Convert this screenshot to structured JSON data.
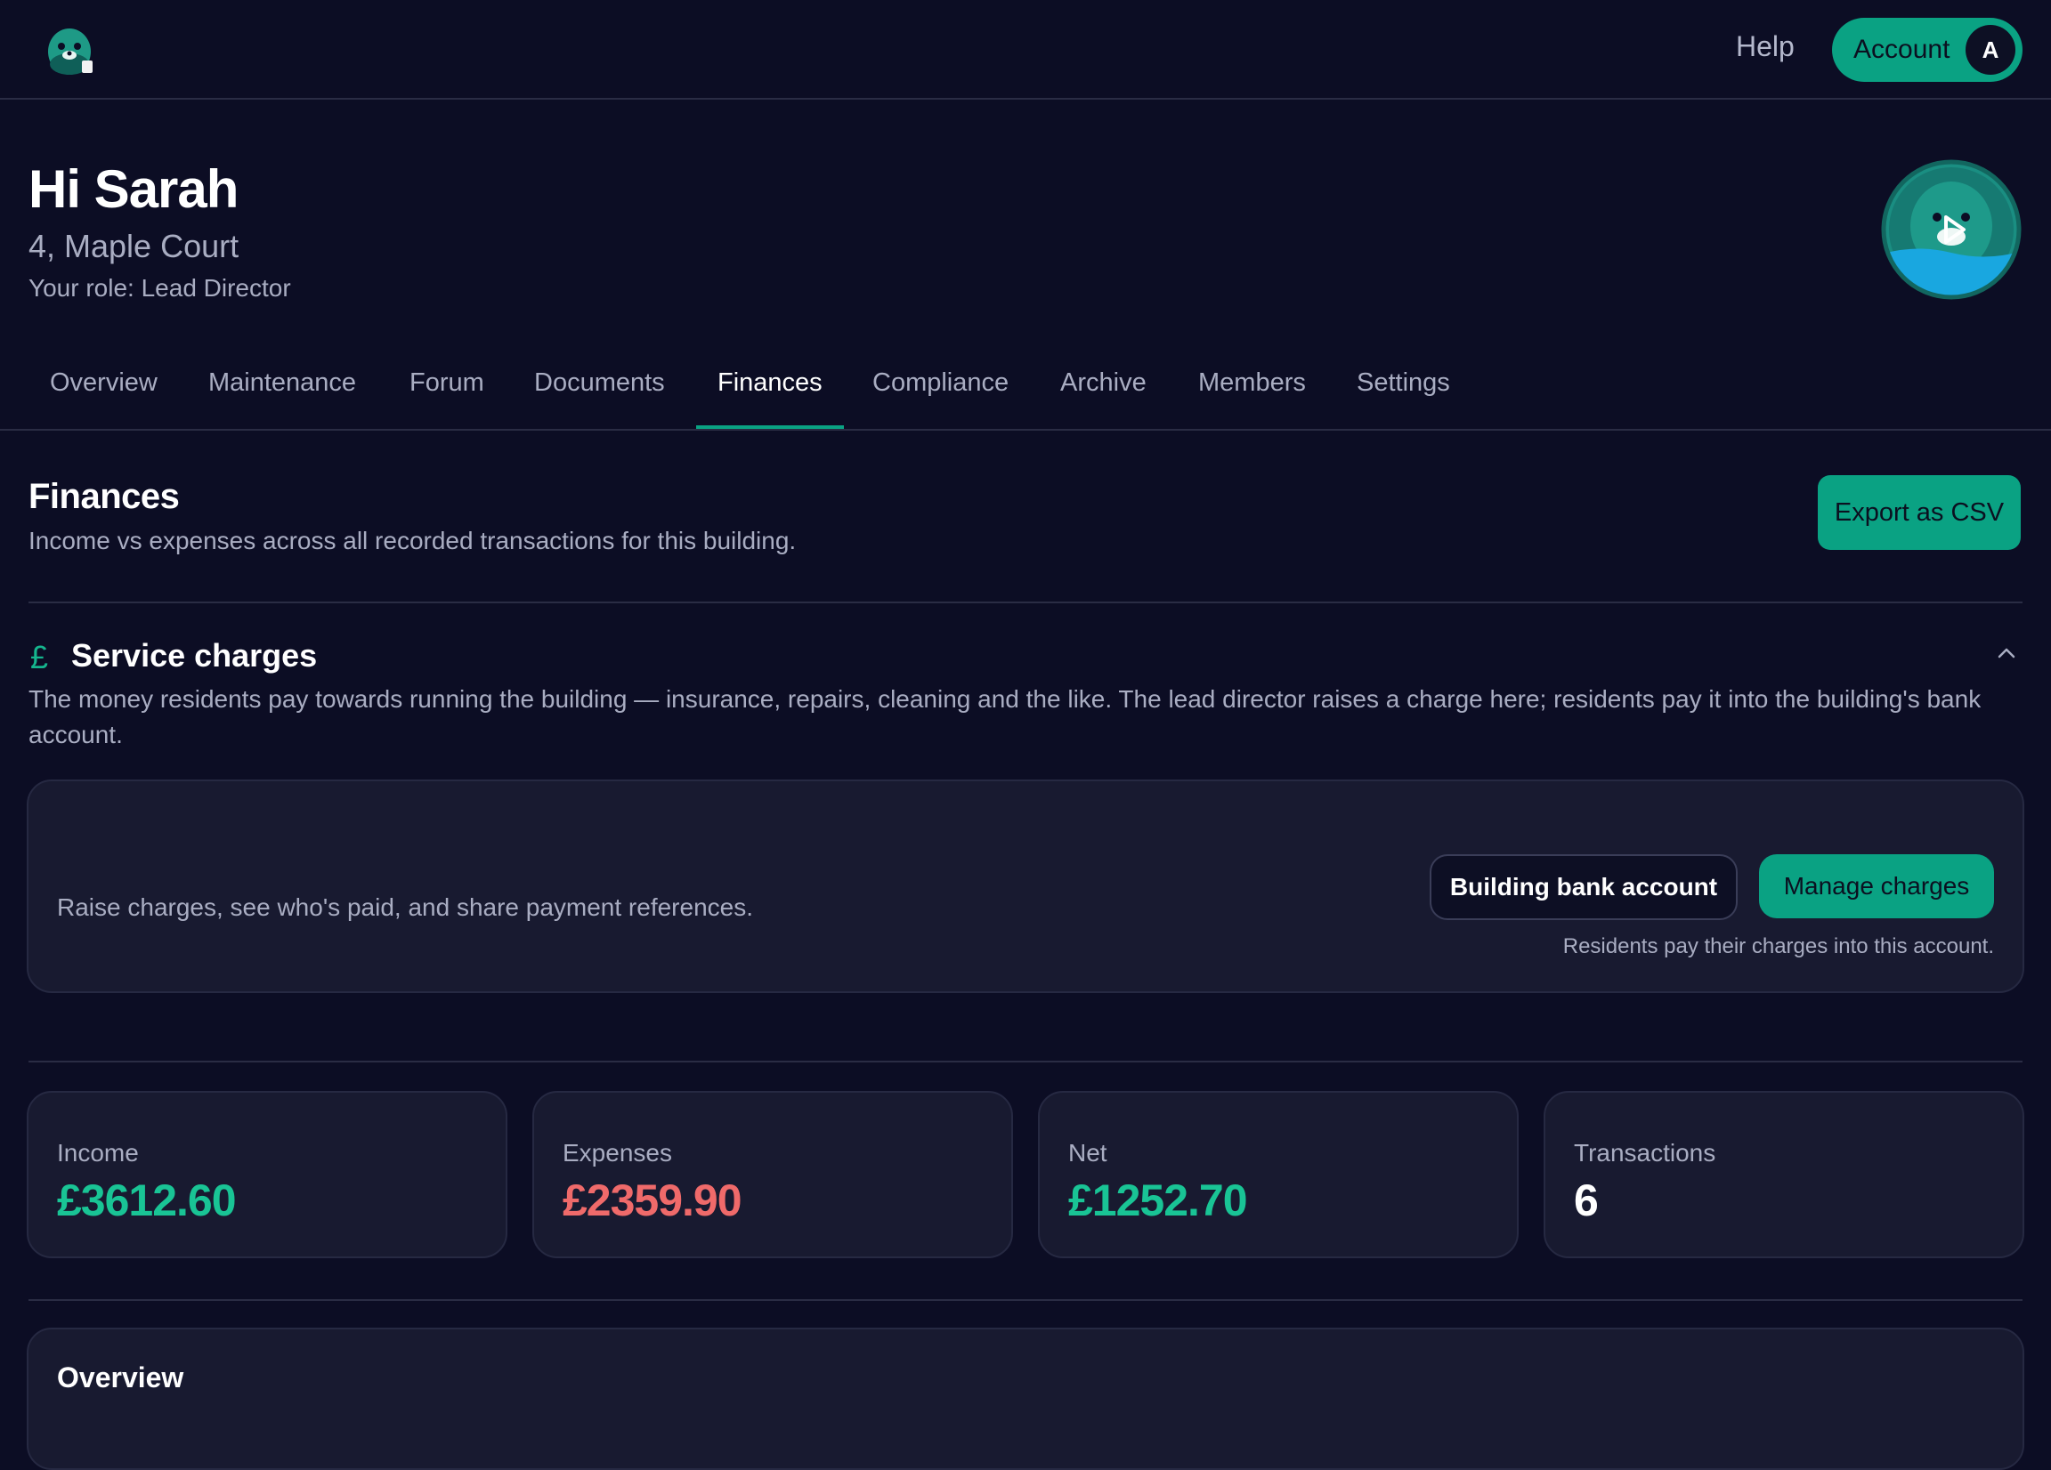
{
  "header": {
    "logo_icon": "seal-mascot-icon",
    "help_label": "Help",
    "account_label": "Account",
    "account_initial": "A"
  },
  "hero": {
    "greeting": "Hi Sarah",
    "address": "4, Maple Court",
    "role": "Your role: Lead Director",
    "avatar_icon": "seal-mascot-avatar"
  },
  "tabs": [
    {
      "label": "Overview",
      "active": false
    },
    {
      "label": "Maintenance",
      "active": false
    },
    {
      "label": "Forum",
      "active": false
    },
    {
      "label": "Documents",
      "active": false
    },
    {
      "label": "Finances",
      "active": true
    },
    {
      "label": "Compliance",
      "active": false
    },
    {
      "label": "Archive",
      "active": false
    },
    {
      "label": "Members",
      "active": false
    },
    {
      "label": "Settings",
      "active": false
    }
  ],
  "finances": {
    "title": "Finances",
    "subtitle": "Income vs expenses across all recorded transactions for this building.",
    "export_label": "Export as CSV"
  },
  "service_charges": {
    "icon": "pound-icon",
    "title": "Service charges",
    "description": "The money residents pay towards running the building — insurance, repairs, cleaning and the like. The lead director raises a charge here; residents pay it into the building's bank account.",
    "card_text": "Raise charges, see who's paid, and share payment references.",
    "bank_button": "Building bank account",
    "manage_button": "Manage charges",
    "bank_note": "Residents pay their charges into this account."
  },
  "stats": [
    {
      "label": "Income",
      "value": "£3612.60",
      "color": "#19c495"
    },
    {
      "label": "Expenses",
      "value": "£2359.90",
      "color": "#ef6a6a"
    },
    {
      "label": "Net",
      "value": "£1252.70",
      "color": "#19c495"
    },
    {
      "label": "Transactions",
      "value": "6",
      "color": "#ffffff"
    }
  ],
  "overview": {
    "title": "Overview"
  },
  "colors": {
    "background": "#0c0d24",
    "accent": "#0aa283",
    "card": "#181a30",
    "income": "#19c495",
    "expense": "#ef6a6a"
  }
}
